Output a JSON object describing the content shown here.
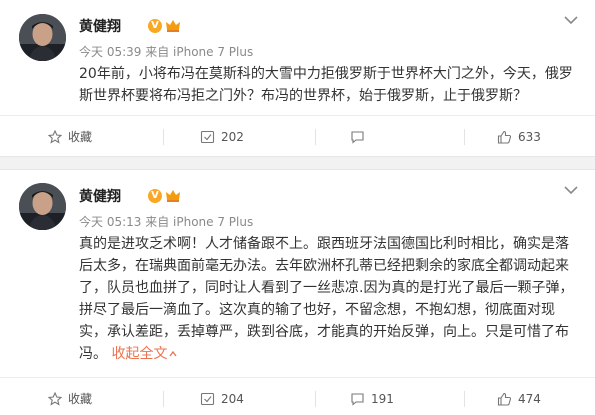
{
  "posts": [
    {
      "author": "黄健翔",
      "meta": "今天 05:39 来自 iPhone 7 Plus",
      "text_lines": [
        "20年前，小将布冯在莫斯科的大雪中力拒俄罗斯于世界杯大门之外，今天，俄罗",
        "斯世界杯要将布冯拒之门外？布冯的世界杯，始于俄罗斯，止于俄罗斯？"
      ],
      "actions": {
        "favorite": "收藏",
        "repost": "202",
        "comment": "",
        "like": "633"
      }
    },
    {
      "author": "黄健翔",
      "meta": "今天 05:13 来自 iPhone 7 Plus",
      "text_lines": [
        "真的是进攻乏术啊！人才储备跟不上。跟西班牙法国德国比利时相比，确实是落",
        "后太多，在瑞典面前毫无办法。去年欧洲杯孔蒂已经把剩余的家底全都调动起来",
        "了，队员也血拼了，同时让人看到了一丝悲凉.因为真的是打光了最后一颗子弹，",
        "拼尽了最后一滴血了。这次真的输了也好，不留念想，不抱幻想，彻底面对现",
        "实，承认差距，丢掉尊严，跌到谷底，才能真的开始反弹，向上。只是可惜了布"
      ],
      "last_line": "冯。",
      "collapse_label": "收起全文",
      "actions": {
        "favorite": "收藏",
        "repost": "204",
        "comment": "191",
        "like": "474"
      }
    }
  ],
  "colors": {
    "link": "#eb7350",
    "badge": "#f9a825",
    "divider": "#f2f2f2"
  },
  "icons": {
    "verified": "verified-badge-icon",
    "vip": "vip-crown-icon",
    "menu": "chevron-down-icon",
    "favorite": "star-icon",
    "repost": "repost-icon",
    "comment": "comment-icon",
    "like": "thumbs-up-icon"
  }
}
